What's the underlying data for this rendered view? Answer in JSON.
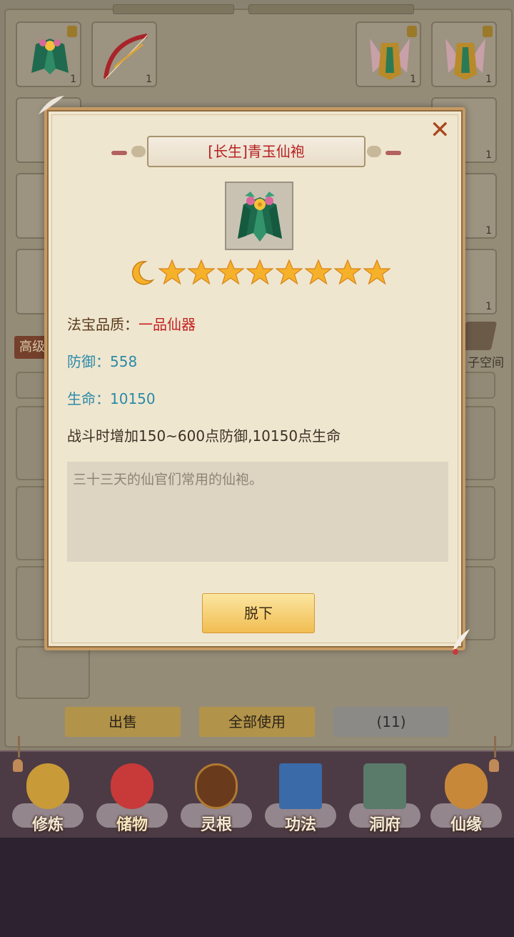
{
  "inventory": {
    "top_slots": [
      {
        "icon": "green-robe-icon",
        "count": "1",
        "locked": true
      },
      {
        "icon": "red-bow-icon",
        "count": "1",
        "locked": false
      },
      {
        "icon": "winged-armor-icon",
        "count": "1",
        "locked": true
      },
      {
        "icon": "winged-armor-icon",
        "count": "1",
        "locked": true
      }
    ],
    "right_column_counts": [
      "1",
      "1",
      "1"
    ],
    "left_tab_label": "高级",
    "right_tab_label": "子空间"
  },
  "bottom_buttons": {
    "sell": "出售",
    "use_all": "全部使用",
    "count": "(11)"
  },
  "nav": {
    "items": [
      {
        "label": "修炼",
        "icon": "hooded-figure-icon"
      },
      {
        "label": "储物",
        "icon": "treasure-bag-icon"
      },
      {
        "label": "灵根",
        "icon": "yin-yang-icon"
      },
      {
        "label": "功法",
        "icon": "scroll-book-icon"
      },
      {
        "label": "洞府",
        "icon": "pavilion-icon"
      },
      {
        "label": "仙缘",
        "icon": "gourd-icon"
      }
    ]
  },
  "modal": {
    "title": "[长生]青玉仙袍",
    "item_icon": "green-jade-robe-icon",
    "rank_icon": "crescent-moon-icon",
    "star_count": 8,
    "quality_label": "法宝品质：",
    "quality_value": "一品仙器",
    "defense_label": "防御：",
    "defense_value": "558",
    "life_label": "生命：",
    "life_value": "10150",
    "effect_text": "战斗时增加150~600点防御,10150点生命",
    "description": "三十三天的仙官们常用的仙袍。",
    "takeoff_button": "脱下"
  },
  "colors": {
    "title_red": "#b62020",
    "quality_red": "#c42020",
    "stat_teal": "#2b8aa8",
    "label_brown": "#5a3a1c",
    "button_gold": "#f1bd52",
    "star_gold": "#f6b12a"
  }
}
